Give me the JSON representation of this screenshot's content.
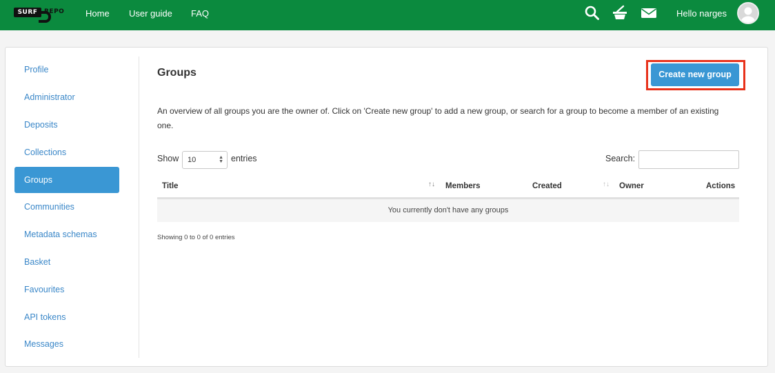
{
  "header": {
    "logo_left": "SURF",
    "logo_right": "REPO",
    "nav": [
      {
        "label": "Home"
      },
      {
        "label": "User guide"
      },
      {
        "label": "FAQ"
      }
    ],
    "icons": [
      "search-icon",
      "basket-icon",
      "mail-icon"
    ],
    "greeting": "Hello narges",
    "brand_color": "#0b8a3e"
  },
  "sidebar": {
    "items": [
      {
        "label": "Profile"
      },
      {
        "label": "Administrator"
      },
      {
        "label": "Deposits"
      },
      {
        "label": "Collections"
      },
      {
        "label": "Groups",
        "active": true
      },
      {
        "label": "Communities"
      },
      {
        "label": "Metadata schemas"
      },
      {
        "label": "Basket"
      },
      {
        "label": "Favourites"
      },
      {
        "label": "API tokens"
      },
      {
        "label": "Messages"
      }
    ]
  },
  "main": {
    "title": "Groups",
    "create_button": "Create new group",
    "description": "An overview of all groups you are the owner of. Click on 'Create new group' to add a new group, or search for a group to become a member of an existing one.",
    "table": {
      "show_label": "Show",
      "entries_value": "10",
      "entries_label": "entries",
      "search_label": "Search:",
      "columns": [
        "Title",
        "Members",
        "Created",
        "Owner",
        "Actions"
      ],
      "empty_message": "You currently don't have any groups",
      "info": "Showing 0 to 0 of 0 entries"
    }
  },
  "colors": {
    "accent": "#3a97d4",
    "highlight": "#e8311a"
  }
}
